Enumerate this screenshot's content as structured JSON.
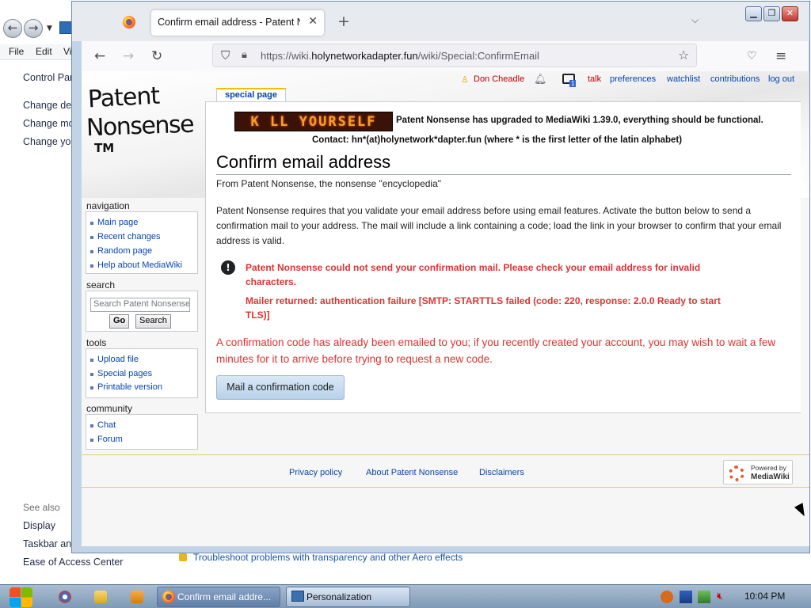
{
  "control_panel": {
    "menu": [
      "File",
      "Edit",
      "Vi"
    ],
    "breadcrumb": "Control Par",
    "links": [
      "Change des",
      "Change mo",
      "Change you"
    ],
    "see_also_label": "See also",
    "see_also": [
      "Display",
      "Taskbar and",
      "Ease of Access Center"
    ],
    "troubleshoot": "Troubleshoot problems with transparency and other Aero effects"
  },
  "browser": {
    "tab_title": "Confirm email address - Patent Nonsense",
    "url_prefix": "https://wiki.",
    "url_domain": "holynetworkadapter.fun",
    "url_path": "/wiki/Special:ConfirmEmail"
  },
  "wiki": {
    "logo": {
      "line1": "Patent",
      "line2": "Nonsense",
      "line3": "TM"
    },
    "personal_tools": {
      "user": "Don Cheadle",
      "badge_count": "1",
      "talk": "talk",
      "preferences": "preferences",
      "watchlist": "watchlist",
      "contributions": "contributions",
      "logout": "log out"
    },
    "special_tab": "special page",
    "navigation": {
      "heading": "navigation",
      "items": [
        "Main page",
        "Recent changes",
        "Random page",
        "Help about MediaWiki"
      ]
    },
    "search": {
      "heading": "search",
      "placeholder": "Search Patent Nonsense",
      "go": "Go",
      "search": "Search"
    },
    "tools": {
      "heading": "tools",
      "items": [
        "Upload file",
        "Special pages",
        "Printable version"
      ]
    },
    "community": {
      "heading": "community",
      "items": [
        "Chat",
        "Forum"
      ]
    },
    "banner_text": "K LL YOURSELF",
    "notice_line1": "Patent Nonsense has upgraded to MediaWiki 1.39.0, everything should be functional.",
    "notice_line2": "Contact: hn*(at)holynetwork*dapter.fun (where * is the first letter of the latin alphabet)",
    "title": "Confirm email address",
    "subtitle": "From Patent Nonsense, the nonsense \"encyclopedia\"",
    "intro": "Patent Nonsense requires that you validate your email address before using email features. Activate the button below to send a confirmation mail to your address. The mail will include a link containing a code; load the link in your browser to confirm that your email address is valid.",
    "error_1": "Patent Nonsense could not send your confirmation mail. Please check your email address for invalid characters.",
    "error_2": "Mailer returned: authentication failure [SMTP: STARTTLS failed (code: 220, response: 2.0.0 Ready to start TLS)]",
    "already_sent": "A confirmation code has already been emailed to you; if you recently created your account, you may wish to wait a few minutes for it to arrive before trying to request a new code.",
    "mail_button": "Mail a confirmation code",
    "footer": {
      "privacy": "Privacy policy",
      "about": "About Patent Nonsense",
      "disclaimers": "Disclaimers",
      "powered_1": "Powered by",
      "powered_2": "MediaWiki"
    }
  },
  "taskbar": {
    "tasks": [
      "Confirm email addre...",
      "Personalization"
    ],
    "clock": "10:04 PM"
  }
}
